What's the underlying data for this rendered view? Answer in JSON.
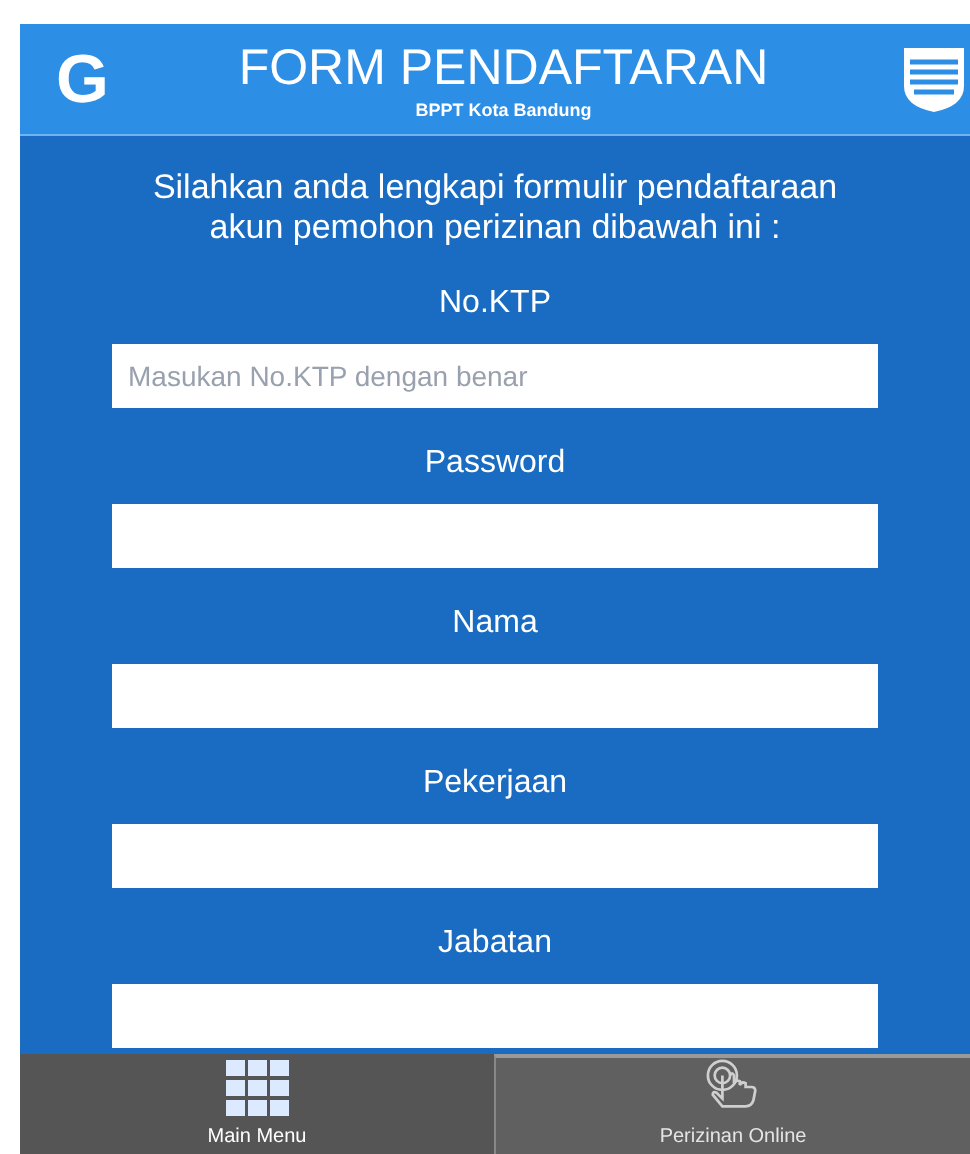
{
  "header": {
    "logo_letter": "G",
    "title": "FORM PENDAFTARAN",
    "subtitle": "BPPT Kota Bandung"
  },
  "intro": "Silahkan anda lengkapi formulir pendaftaraan akun pemohon perizinan dibawah ini :",
  "fields": [
    {
      "label": "No.KTP",
      "placeholder": "Masukan No.KTP dengan benar"
    },
    {
      "label": "Password"
    },
    {
      "label": "Nama"
    },
    {
      "label": "Pekerjaan"
    },
    {
      "label": "Jabatan"
    }
  ],
  "bottom_nav": [
    {
      "label": "Main Menu",
      "kind": "grid",
      "selected": false
    },
    {
      "label": "Perizinan Online",
      "kind": "touch",
      "selected": true
    }
  ]
}
